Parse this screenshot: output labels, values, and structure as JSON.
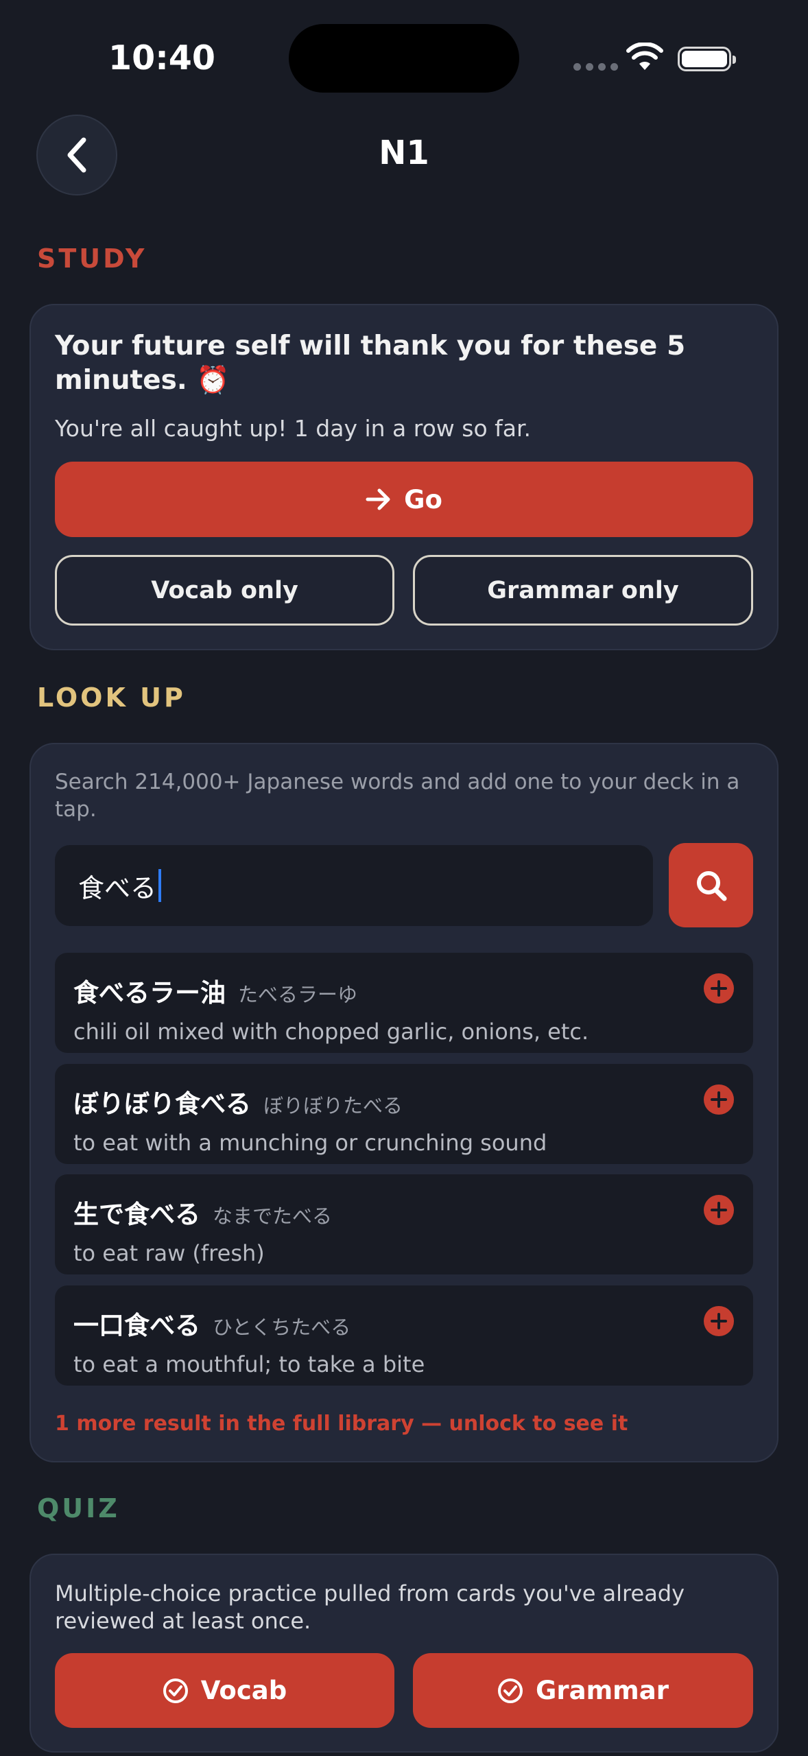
{
  "status_bar": {
    "time": "10:40"
  },
  "header": {
    "title": "N1",
    "back_icon": "chevron-left-icon"
  },
  "colors": {
    "background": "#181b24",
    "card": "#232838",
    "accent": "#c63d2f",
    "study_label": "#c84a3a",
    "lookup_label": "#e2c47e",
    "quiz_label": "#4e8a6a"
  },
  "study": {
    "label": "STUDY",
    "heading": "Your future self will thank you for these 5 minutes. ⏰",
    "subtext": "You're all caught up! 1 day in a row so far.",
    "go_button": "Go",
    "go_icon": "arrow-right-icon",
    "vocab_only_button": "Vocab only",
    "grammar_only_button": "Grammar only"
  },
  "lookup": {
    "label": "LOOK UP",
    "description": "Search 214,000+ Japanese words and add one to your deck in a tap.",
    "search_value": "食べる",
    "search_icon": "search-icon",
    "results": [
      {
        "word": "食べるラー油",
        "reading": "たべるラーゆ",
        "gloss": "chili oil mixed with chopped garlic, onions, etc."
      },
      {
        "word": "ぼりぼり食べる",
        "reading": "ぼりぼりたべる",
        "gloss": "to eat with a munching or crunching sound"
      },
      {
        "word": "生で食べる",
        "reading": "なまでたべる",
        "gloss": "to eat raw (fresh)"
      },
      {
        "word": "一口食べる",
        "reading": "ひとくちたべる",
        "gloss": "to eat a mouthful; to take a bite"
      }
    ],
    "more_results": "1 more result in the full library — unlock to see it"
  },
  "quiz": {
    "label": "QUIZ",
    "description": "Multiple-choice practice pulled from cards you've already reviewed at least once.",
    "vocab_button": "Vocab",
    "grammar_button": "Grammar",
    "button_icon": "check-circle-icon"
  }
}
